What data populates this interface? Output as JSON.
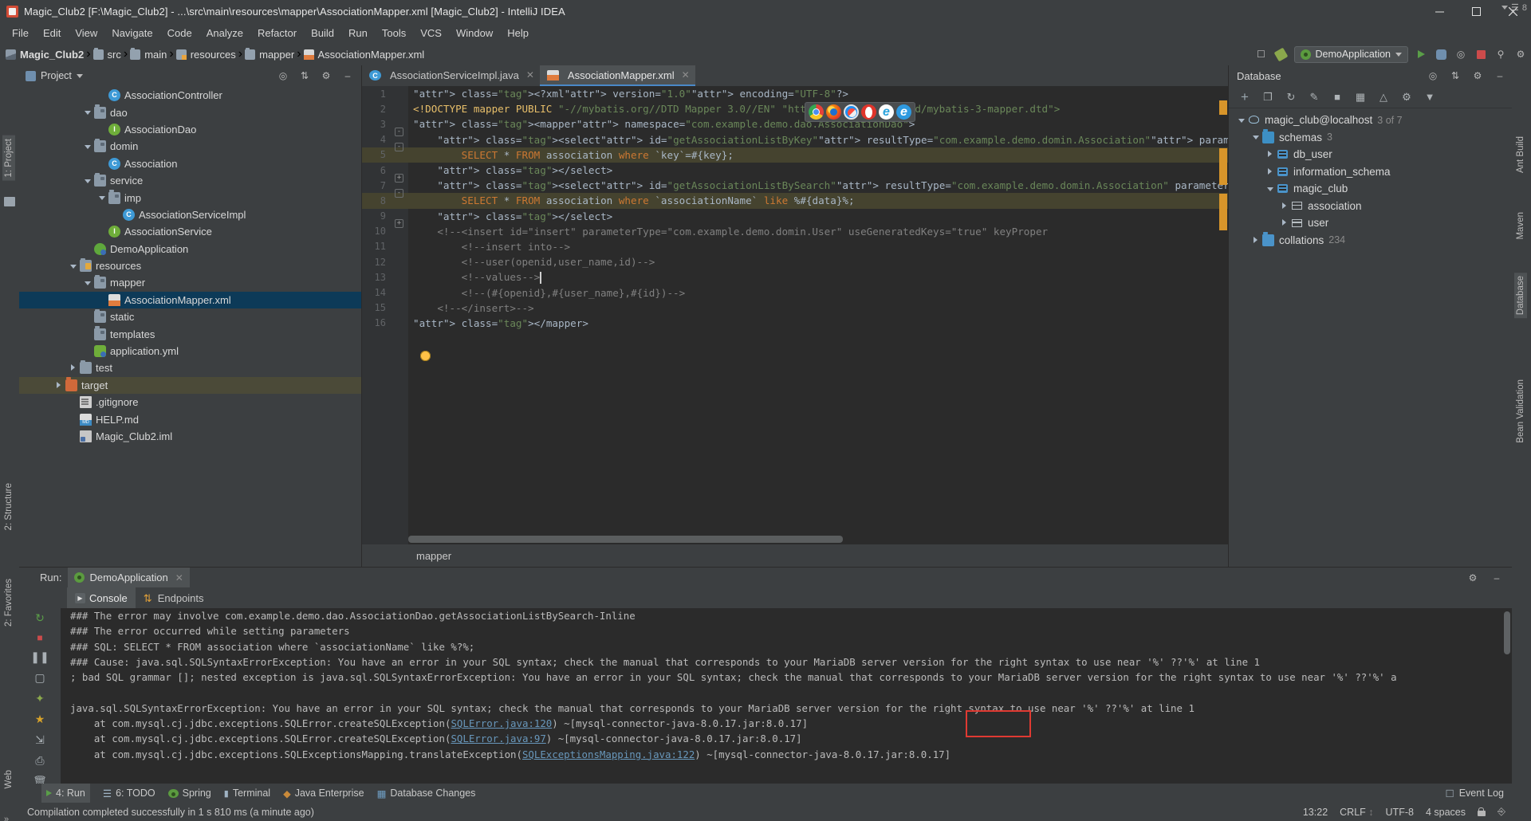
{
  "window": {
    "title": "Magic_Club2 [F:\\Magic_Club2] - ...\\src\\main\\resources\\mapper\\AssociationMapper.xml [Magic_Club2] - IntelliJ IDEA",
    "minimize": "–",
    "maximize": "□",
    "close": "✕"
  },
  "menu": [
    "File",
    "Edit",
    "View",
    "Navigate",
    "Code",
    "Analyze",
    "Refactor",
    "Build",
    "Run",
    "Tools",
    "VCS",
    "Window",
    "Help"
  ],
  "breadcrumb": [
    {
      "label": "Magic_Club2",
      "icon": "module-icon"
    },
    {
      "label": "src",
      "icon": "folder-icon"
    },
    {
      "label": "main",
      "icon": "folder-icon"
    },
    {
      "label": "resources",
      "icon": "resources-folder-icon"
    },
    {
      "label": "mapper",
      "icon": "folder-icon"
    },
    {
      "label": "AssociationMapper.xml",
      "icon": "xml-file-icon"
    }
  ],
  "toolbar": {
    "run_config": "DemoApplication",
    "icons": [
      "search-everywhere-icon",
      "settings-icon",
      "run-icon",
      "debug-icon",
      "coverage-icon",
      "stop-icon",
      "build-icon"
    ]
  },
  "left_strips": [
    {
      "label": "1: Project",
      "active": true
    },
    {
      "label": "2: Structure",
      "active": false
    },
    {
      "label": "2: Favorites",
      "active": false
    },
    {
      "label": "Web",
      "active": false
    }
  ],
  "right_strips": [
    {
      "label": "Ant Build"
    },
    {
      "label": "Maven"
    },
    {
      "label": "Database"
    },
    {
      "label": "Bean Validation"
    }
  ],
  "project": {
    "title": "Project",
    "tree": [
      {
        "label": "AssociationController",
        "indent": 5,
        "icon": "class-icon",
        "arrow": "none"
      },
      {
        "label": "dao",
        "indent": 4,
        "icon": "folder-icon",
        "arrow": "down"
      },
      {
        "label": "AssociationDao",
        "indent": 5,
        "icon": "interface-icon",
        "arrow": "none"
      },
      {
        "label": "domin",
        "indent": 4,
        "icon": "folder-icon",
        "arrow": "down"
      },
      {
        "label": "Association",
        "indent": 5,
        "icon": "class-icon",
        "arrow": "none"
      },
      {
        "label": "service",
        "indent": 4,
        "icon": "folder-icon",
        "arrow": "down"
      },
      {
        "label": "imp",
        "indent": 5,
        "icon": "folder-icon",
        "arrow": "down"
      },
      {
        "label": "AssociationServiceImpl",
        "indent": 6,
        "icon": "class-icon",
        "arrow": "none"
      },
      {
        "label": "AssociationService",
        "indent": 5,
        "icon": "interface-icon",
        "arrow": "none"
      },
      {
        "label": "DemoApplication",
        "indent": 4,
        "icon": "spring-icon",
        "arrow": "none"
      },
      {
        "label": "resources",
        "indent": 3,
        "icon": "resources-folder-icon",
        "arrow": "down"
      },
      {
        "label": "mapper",
        "indent": 4,
        "icon": "folder-icon",
        "arrow": "down"
      },
      {
        "label": "AssociationMapper.xml",
        "indent": 5,
        "icon": "xml-file-icon",
        "arrow": "none",
        "selected": true
      },
      {
        "label": "static",
        "indent": 4,
        "icon": "folder-icon",
        "arrow": "none"
      },
      {
        "label": "templates",
        "indent": 4,
        "icon": "folder-icon",
        "arrow": "none"
      },
      {
        "label": "application.yml",
        "indent": 4,
        "icon": "yml-file-icon",
        "arrow": "none"
      },
      {
        "label": "test",
        "indent": 3,
        "icon": "folder-plain-icon",
        "arrow": "right"
      },
      {
        "label": "target",
        "indent": 2,
        "icon": "target-folder-icon",
        "arrow": "right",
        "highlight": true
      },
      {
        "label": ".gitignore",
        "indent": 3,
        "icon": "file-icon",
        "arrow": "none"
      },
      {
        "label": "HELP.md",
        "indent": 3,
        "icon": "markdown-icon",
        "arrow": "none"
      },
      {
        "label": "Magic_Club2.iml",
        "indent": 3,
        "icon": "iml-icon",
        "arrow": "none"
      }
    ]
  },
  "editor": {
    "tabs": [
      {
        "label": "AssociationServiceImpl.java",
        "icon": "java-class-icon",
        "active": false
      },
      {
        "label": "AssociationMapper.xml",
        "icon": "xml-file-icon",
        "active": true
      }
    ],
    "status_path": "mapper",
    "inspection_count": "8",
    "lines": [
      {
        "n": "1",
        "text": "<?xml version=\"1.0\" encoding=\"UTF-8\"?>"
      },
      {
        "n": "2",
        "text": "<!DOCTYPE mapper PUBLIC \"-//mybatis.org//DTD Mapper 3.0//EN\" \"http://mybatis.org/dtd/mybatis-3-mapper.dtd\">"
      },
      {
        "n": "3",
        "text": "<mapper namespace=\"com.example.demo.dao.AssociationDao\">"
      },
      {
        "n": "4",
        "text": "    <select id=\"getAssociationListByKey\" resultType=\"com.example.demo.domin.Association\" parameterType=\"i"
      },
      {
        "n": "5",
        "text": "        SELECT * FROM association where `key`=#{key};"
      },
      {
        "n": "6",
        "text": "    </select>"
      },
      {
        "n": "7",
        "text": "    <select id=\"getAssociationListBySearch\" resultType=\"com.example.demo.domin.Association\" parameterType"
      },
      {
        "n": "8",
        "text": "        SELECT * FROM association where `associationName` like %#{data}%;"
      },
      {
        "n": "9",
        "text": "    </select>"
      },
      {
        "n": "10",
        "text": "    <!--<insert id=\"insert\" parameterType=\"com.example.demo.domin.User\" useGeneratedKeys=\"true\" keyProper"
      },
      {
        "n": "11",
        "text": "        <!--insert into-->"
      },
      {
        "n": "12",
        "text": "        <!--user(openid,user_name,id)-->"
      },
      {
        "n": "13",
        "text": "        <!--values-->"
      },
      {
        "n": "14",
        "text": "        <!--(#{openid},#{user_name},#{id})-->"
      },
      {
        "n": "15",
        "text": "    <!--</insert>-->"
      },
      {
        "n": "16",
        "text": "</mapper>"
      }
    ],
    "browser_popup": [
      "chrome-icon",
      "firefox-icon",
      "safari-icon",
      "opera-icon",
      "ie-icon",
      "edge-icon"
    ]
  },
  "database": {
    "title": "Database",
    "toolbar_icons": [
      "add-icon",
      "copy-icon",
      "refresh-icon",
      "edit-script-icon",
      "stop-icon",
      "table-icon",
      "chart-icon",
      "settings-icon",
      "filter-icon"
    ],
    "tree": [
      {
        "label": "magic_club@localhost",
        "count": "3 of 7",
        "indent": 0,
        "icon": "mariadb-icon",
        "arrow": "down"
      },
      {
        "label": "schemas",
        "count": "3",
        "indent": 1,
        "icon": "schemas-folder-icon",
        "arrow": "down"
      },
      {
        "label": "db_user",
        "count": "",
        "indent": 2,
        "icon": "schema-icon",
        "arrow": "right"
      },
      {
        "label": "information_schema",
        "count": "",
        "indent": 2,
        "icon": "schema-icon",
        "arrow": "right"
      },
      {
        "label": "magic_club",
        "count": "",
        "indent": 2,
        "icon": "schema-icon",
        "arrow": "down"
      },
      {
        "label": "association",
        "count": "",
        "indent": 3,
        "icon": "table-icon",
        "arrow": "right"
      },
      {
        "label": "user",
        "count": "",
        "indent": 3,
        "icon": "table-icon",
        "arrow": "right"
      },
      {
        "label": "collations",
        "count": "234",
        "indent": 1,
        "icon": "collations-folder-icon",
        "arrow": "right"
      }
    ]
  },
  "run": {
    "label": "Run:",
    "config_tab": "DemoApplication",
    "tabs": [
      {
        "label": "Console",
        "icon": "console-icon",
        "active": true
      },
      {
        "label": "Endpoints",
        "icon": "endpoints-icon",
        "active": false
      }
    ],
    "sidebar_icons": [
      "rerun-icon",
      "up-arrow-icon",
      "down-arrow-icon",
      "stop-icon",
      "pause-icon",
      "camera-icon",
      "thread-icon",
      "star-icon",
      "export-icon",
      "print-icon",
      "trash-icon",
      "more-icon"
    ],
    "console_lines": [
      {
        "text": "### The error may involve com.example.demo.dao.AssociationDao.getAssociationListBySearch-Inline",
        "type": "plain"
      },
      {
        "text": "### The error occurred while setting parameters",
        "type": "plain"
      },
      {
        "text": "### SQL: SELECT * FROM association where `associationName` like %?%;",
        "type": "plain"
      },
      {
        "text": "### Cause: java.sql.SQLSyntaxErrorException: You have an error in your SQL syntax; check the manual that corresponds to your MariaDB server version for the right syntax to use near '%' ??'%' at line 1",
        "type": "plain"
      },
      {
        "text": "; bad SQL grammar []; nested exception is java.sql.SQLSyntaxErrorException: You have an error in your SQL syntax; check the manual that corresponds to your MariaDB server version for the right syntax to use near '%' ??'%' a",
        "type": "plain"
      },
      {
        "text": "",
        "type": "plain"
      },
      {
        "text": "java.sql.SQLSyntaxErrorException: You have an error in your SQL syntax; check the manual that corresponds to your MariaDB server version for the right syntax to use near '%' ??'%' at line 1",
        "type": "plain"
      },
      {
        "text": "    at com.mysql.cj.jdbc.exceptions.SQLError.createSQLException(SQLError.java:120) ~[mysql-connector-java-8.0.17.jar:8.0.17]",
        "type": "link",
        "link": "SQLError.java:120"
      },
      {
        "text": "    at com.mysql.cj.jdbc.exceptions.SQLError.createSQLException(SQLError.java:97) ~[mysql-connector-java-8.0.17.jar:8.0.17]",
        "type": "link",
        "link": "SQLError.java:97"
      },
      {
        "text": "    at com.mysql.cj.jdbc.exceptions.SQLExceptionsMapping.translateException(SQLExceptionsMapping.java:122) ~[mysql-connector-java-8.0.17.jar:8.0.17]",
        "type": "link",
        "link": "SQLExceptionsMapping.java:122"
      }
    ],
    "highlight_text": "'%'??'%'"
  },
  "bottom_tools": [
    {
      "label": "4: Run",
      "icon": "run-icon",
      "active": true
    },
    {
      "label": "6: TODO",
      "icon": "todo-icon",
      "active": false
    },
    {
      "label": "Spring",
      "icon": "spring-icon",
      "active": false
    },
    {
      "label": "Terminal",
      "icon": "terminal-icon",
      "active": false
    },
    {
      "label": "Java Enterprise",
      "icon": "java-ee-icon",
      "active": false
    },
    {
      "label": "Database Changes",
      "icon": "db-changes-icon",
      "active": false
    }
  ],
  "bottom_right": {
    "label": "Event Log",
    "icon": "event-log-icon"
  },
  "statusbar": {
    "message": "Compilation completed successfully in 1 s 810 ms (a minute ago)",
    "time": "13:22",
    "line_sep": "CRLF",
    "encoding": "UTF-8",
    "indent": "4 spaces",
    "lock": "lock-icon",
    "branch": "branch-icon"
  }
}
